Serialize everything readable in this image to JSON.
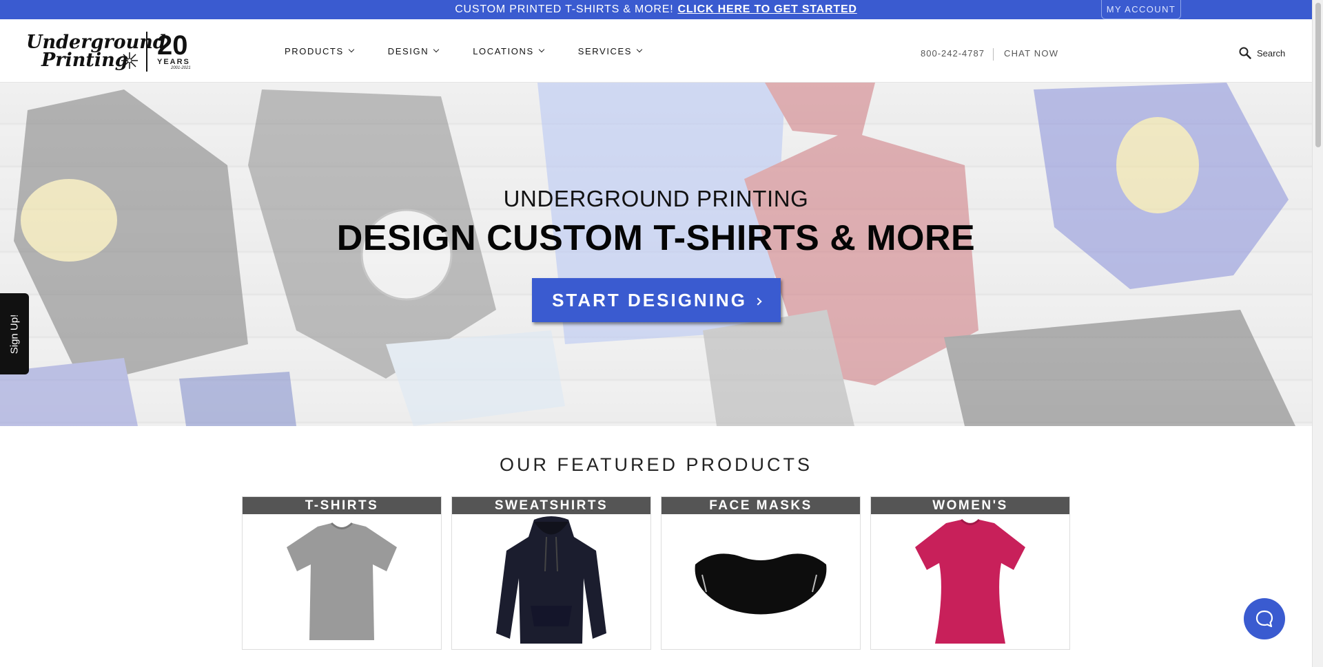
{
  "promo": {
    "text": "CUSTOM PRINTED T-SHIRTS & MORE!",
    "link": "CLICK HERE TO GET STARTED"
  },
  "account": {
    "label": "MY ACCOUNT"
  },
  "brand": {
    "line1": "Underground",
    "line2": "Printing",
    "years_number": "20",
    "years_label": "YEARS",
    "years_dates": "2001-2021"
  },
  "nav": {
    "items": [
      {
        "label": "PRODUCTS"
      },
      {
        "label": "DESIGN"
      },
      {
        "label": "LOCATIONS"
      },
      {
        "label": "SERVICES"
      }
    ]
  },
  "contact": {
    "phone": "800-242-4787",
    "chat": "CHAT NOW"
  },
  "search": {
    "label": "Search",
    "icon": "search-icon"
  },
  "hero": {
    "eyebrow": "UNDERGROUND PRINTING",
    "title": "DESIGN CUSTOM T-SHIRTS & MORE",
    "cta": "START DESIGNING"
  },
  "signup": {
    "label": "Sign Up!"
  },
  "featured": {
    "heading": "OUR FEATURED PRODUCTS",
    "products": [
      {
        "label": "T-SHIRTS",
        "color": "#9a9a9a"
      },
      {
        "label": "SWEATSHIRTS",
        "color": "#1b1d2e"
      },
      {
        "label": "FACE MASKS",
        "color": "#0d0d0d"
      },
      {
        "label": "WOMEN'S",
        "color": "#c8205a"
      }
    ]
  },
  "colors": {
    "accent": "#3a5bd0",
    "label_bg": "#555555"
  }
}
